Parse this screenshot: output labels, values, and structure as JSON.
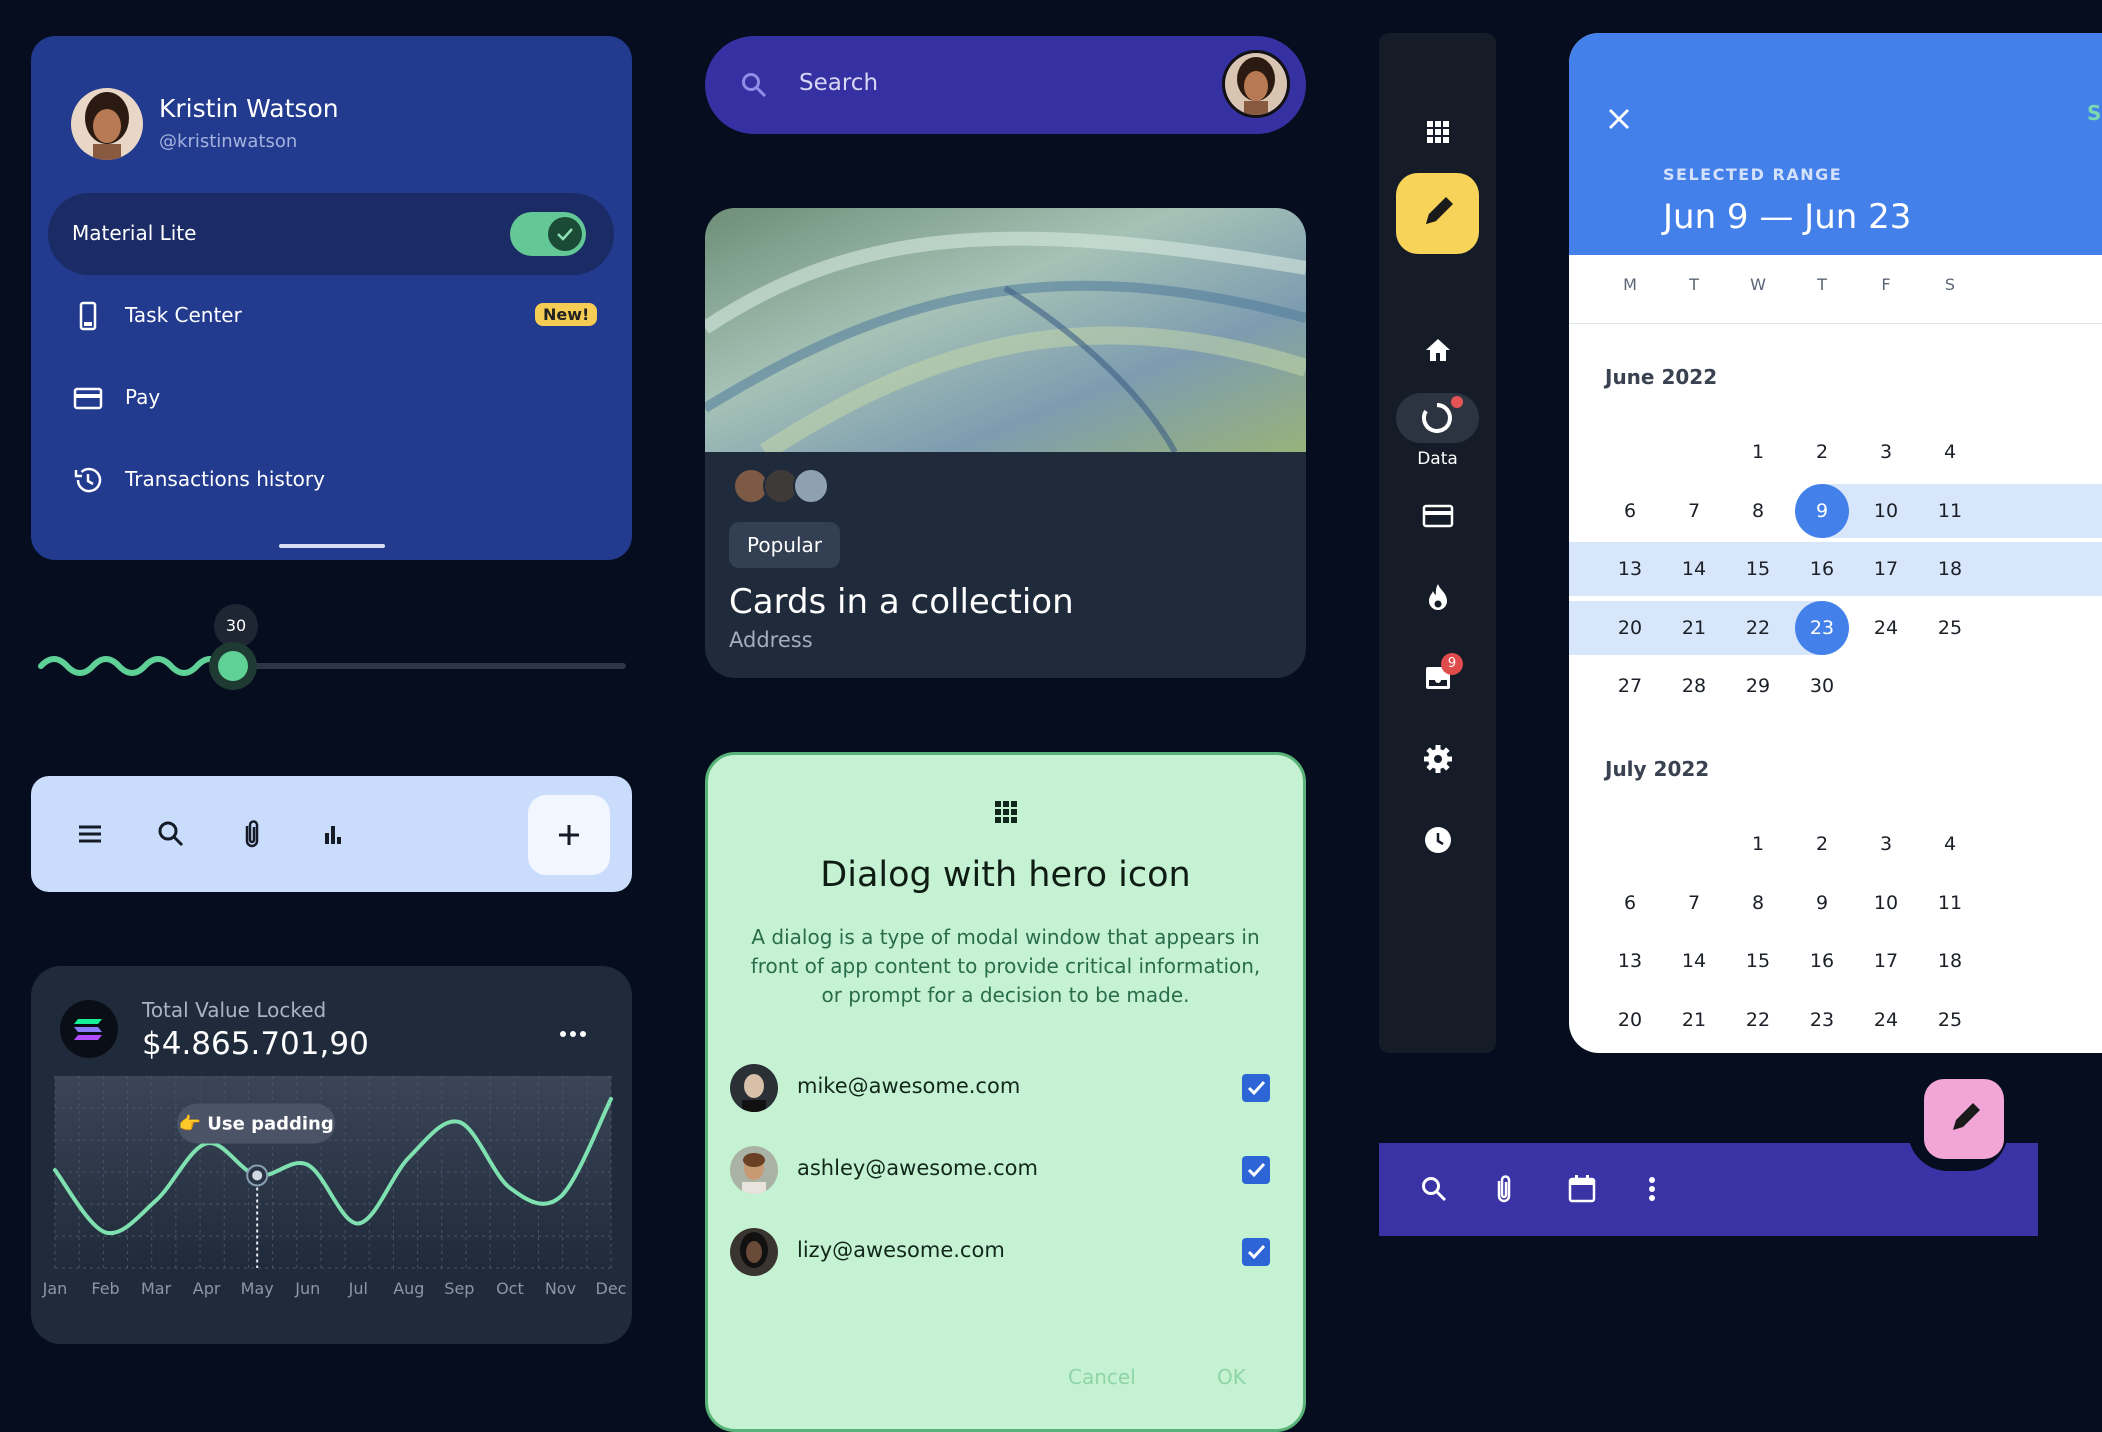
{
  "drawer": {
    "user_name": "Kristin Watson",
    "user_handle": "@kristinwatson",
    "active_item": "Material Lite",
    "toggle_on": true,
    "items": [
      {
        "label": "Task Center",
        "icon": "phone-icon",
        "badge": "New!"
      },
      {
        "label": "Pay",
        "icon": "credit-card-icon"
      },
      {
        "label": "Transactions history",
        "icon": "history-icon"
      }
    ]
  },
  "slider": {
    "value": "30",
    "percent": 33
  },
  "lightbar": {
    "icons": [
      "menu-icon",
      "search-icon",
      "attach-icon",
      "bar-chart-icon"
    ],
    "fab_icon": "plus-icon"
  },
  "tvl": {
    "label": "Total Value Locked",
    "value": "$4.865.701,90",
    "tooltip": "👉 Use padding"
  },
  "chart_data": {
    "type": "line",
    "categories": [
      "Jan",
      "Feb",
      "Mar",
      "Apr",
      "May",
      "Jun",
      "Jul",
      "Aug",
      "Sep",
      "Oct",
      "Nov",
      "Dec"
    ],
    "series": [
      {
        "values": [
          55,
          20,
          38,
          70,
          52,
          58,
          25,
          62,
          82,
          45,
          40,
          95
        ]
      }
    ],
    "ylim": [
      0,
      100
    ],
    "highlight_index": 4,
    "grid": true
  },
  "search": {
    "placeholder": "Search"
  },
  "card": {
    "chip": "Popular",
    "title": "Cards in a collection",
    "subtitle": "Address"
  },
  "dialog": {
    "title": "Dialog with hero icon",
    "body": "A dialog is a type of modal window that appears in front of app content to provide critical information, or prompt for a decision to be made.",
    "recipients": [
      {
        "email": "mike@awesome.com",
        "checked": true
      },
      {
        "email": "ashley@awesome.com",
        "checked": true
      },
      {
        "email": "lizy@awesome.com",
        "checked": true
      }
    ],
    "cancel": "Cancel",
    "ok": "OK"
  },
  "rail": {
    "data_label": "Data",
    "inbox_badge": "9",
    "icons": [
      "apps-icon",
      "pencil-icon",
      "home-icon",
      "data-icon",
      "credit-card-icon",
      "fire-icon",
      "inbox-icon",
      "settings-icon",
      "clock-icon"
    ]
  },
  "picker": {
    "save": "Sa",
    "range_label": "SELECTED RANGE",
    "range_value": "Jun 9 — Jun 23",
    "weekdays": [
      "M",
      "T",
      "W",
      "T",
      "F",
      "S"
    ],
    "months": [
      {
        "name": "June 2022",
        "weeks": [
          [
            "",
            "",
            "1",
            "2",
            "3",
            "4"
          ],
          [
            "6",
            "7",
            "8",
            "9",
            "10",
            "11"
          ],
          [
            "13",
            "14",
            "15",
            "16",
            "17",
            "18"
          ],
          [
            "20",
            "21",
            "22",
            "23",
            "24",
            "25"
          ],
          [
            "27",
            "28",
            "29",
            "30",
            "",
            ""
          ]
        ]
      },
      {
        "name": "July 2022",
        "weeks": [
          [
            "",
            "",
            "1",
            "2",
            "3",
            "4"
          ],
          [
            "6",
            "7",
            "8",
            "9",
            "10",
            "11"
          ],
          [
            "13",
            "14",
            "15",
            "16",
            "17",
            "18"
          ],
          [
            "20",
            "21",
            "22",
            "23",
            "24",
            "25"
          ]
        ]
      }
    ],
    "range_start": "9",
    "range_end": "23"
  },
  "appbar": {
    "icons": [
      "search-icon",
      "attach-icon",
      "calendar-icon",
      "more-vert-icon"
    ],
    "fab_icon": "pencil-icon"
  },
  "colors": {
    "background": "#050d1e",
    "drawer": "#233b8f",
    "accent_green": "#63c895",
    "indigo": "#3a33a6",
    "picker_blue": "#4480ea"
  }
}
